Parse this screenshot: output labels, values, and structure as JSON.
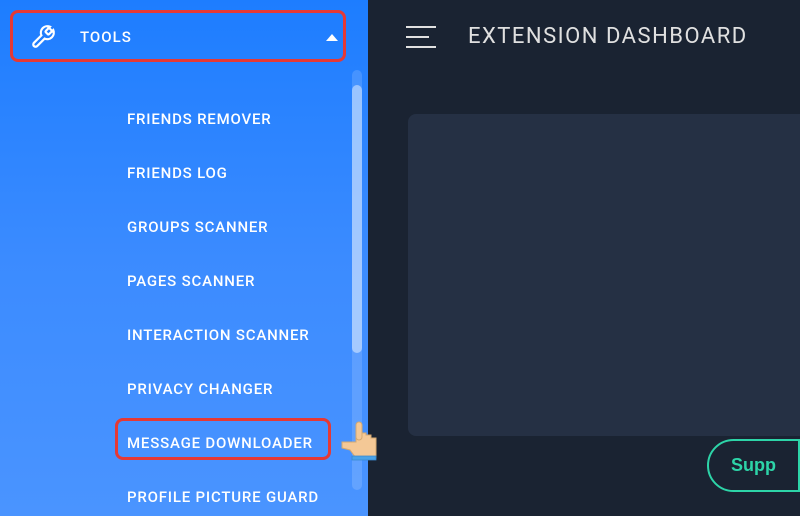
{
  "sidebar": {
    "header": {
      "label": "TOOLS"
    },
    "items": [
      {
        "label": "FRIENDS REMOVER"
      },
      {
        "label": "FRIENDS LOG"
      },
      {
        "label": "GROUPS SCANNER"
      },
      {
        "label": "PAGES SCANNER"
      },
      {
        "label": "INTERACTION SCANNER"
      },
      {
        "label": "PRIVACY CHANGER"
      },
      {
        "label": "MESSAGE DOWNLOADER"
      },
      {
        "label": "PROFILE PICTURE GUARD"
      }
    ]
  },
  "header": {
    "title": "EXTENSION DASHBOARD"
  },
  "buttons": {
    "support": "Supp"
  },
  "colors": {
    "sidebar_gradient_top": "#1d7dff",
    "sidebar_gradient_bottom": "#4a94ff",
    "main_bg": "#1a2332",
    "panel_bg": "#253044",
    "accent": "#2dd4a8",
    "highlight": "#e53935"
  }
}
